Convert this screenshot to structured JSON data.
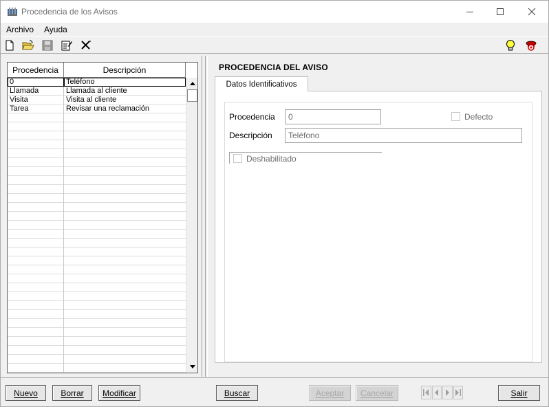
{
  "window": {
    "title": "Procedencia de los Avisos"
  },
  "menu": {
    "items": [
      "Archivo",
      "Ayuda"
    ]
  },
  "toolbar": {
    "icons": [
      "new-document-icon",
      "open-folder-icon",
      "save-disk-icon",
      "edit-notepad-icon",
      "delete-x-icon",
      "lightbulb-icon",
      "help-lifebuoy-icon"
    ]
  },
  "grid": {
    "columns": [
      "Procedencia",
      "Descripción"
    ],
    "rows": [
      {
        "procedencia": "0",
        "descripcion": "Teléfono"
      },
      {
        "procedencia": "Llamada",
        "descripcion": "Llamada al cliente"
      },
      {
        "procedencia": "Visita",
        "descripcion": "Visita al cliente"
      },
      {
        "procedencia": "Tarea",
        "descripcion": "Revisar una reclamación"
      }
    ],
    "selected_index": 0
  },
  "detail": {
    "title": "PROCEDENCIA DEL AVISO",
    "tab_label": "Datos Identificativos",
    "procedencia_label": "Procedencia",
    "procedencia_value": "0",
    "defecto_label": "Defecto",
    "descripcion_label": "Descripción",
    "descripcion_value": "Teléfono",
    "deshabilitado_label": "Deshabilitado"
  },
  "buttons": {
    "nuevo": "Nuevo",
    "borrar": "Borrar",
    "modificar": "Modificar",
    "buscar": "Buscar",
    "aceptar": "Aceptar",
    "cancelar": "Cancelar",
    "salir": "Salir"
  }
}
